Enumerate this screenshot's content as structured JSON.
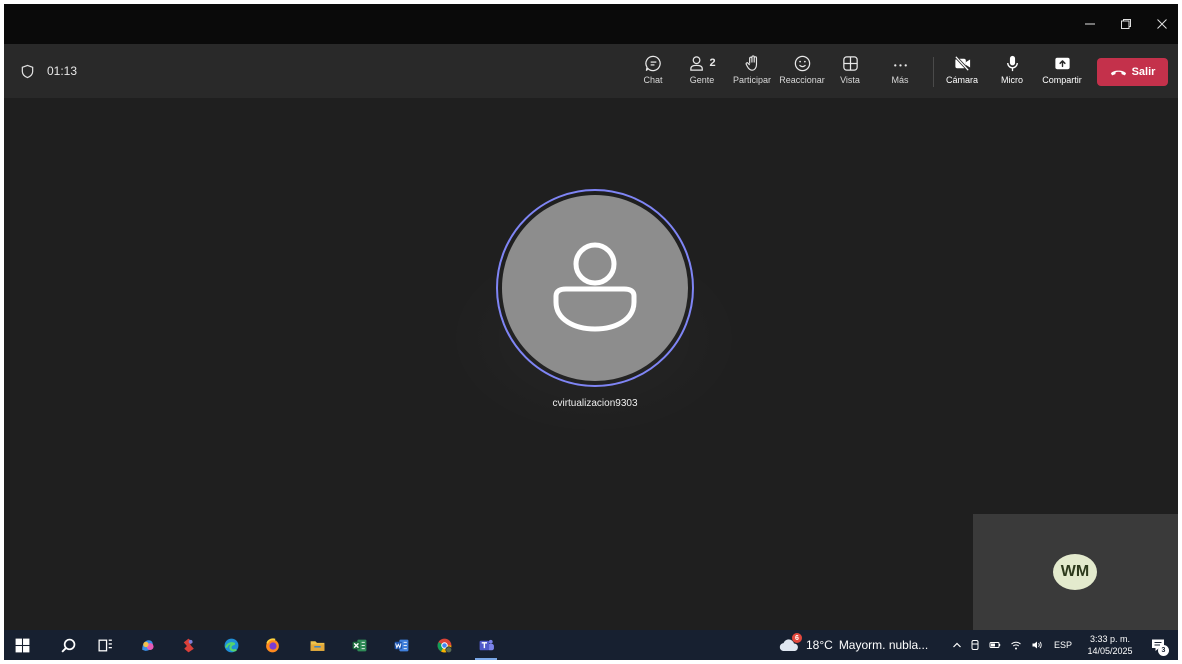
{
  "window": {
    "title": ""
  },
  "toolbar": {
    "timer": "01:13",
    "chat_label": "Chat",
    "people_label": "Gente",
    "people_count": "2",
    "raise_label": "Participar",
    "react_label": "Reaccionar",
    "view_label": "Vista",
    "more_label": "Más",
    "camera_label": "Cámara",
    "mic_label": "Micro",
    "share_label": "Compartir",
    "leave_label": "Salir"
  },
  "stage": {
    "participant_name": "cvirtualizacion9303",
    "self_initials": "WM"
  },
  "taskbar": {
    "weather_temp": "18°C",
    "weather_text": "Mayorm. nubla...",
    "weather_badge": "6",
    "language": "ESP",
    "time": "3:33 p. m.",
    "date": "14/05/2025",
    "notification_count": "3"
  },
  "colors": {
    "leave": "#c4314b",
    "ring": "#7f85f5",
    "taskbar": "#172030",
    "self_avatar": "#e3eacd"
  }
}
